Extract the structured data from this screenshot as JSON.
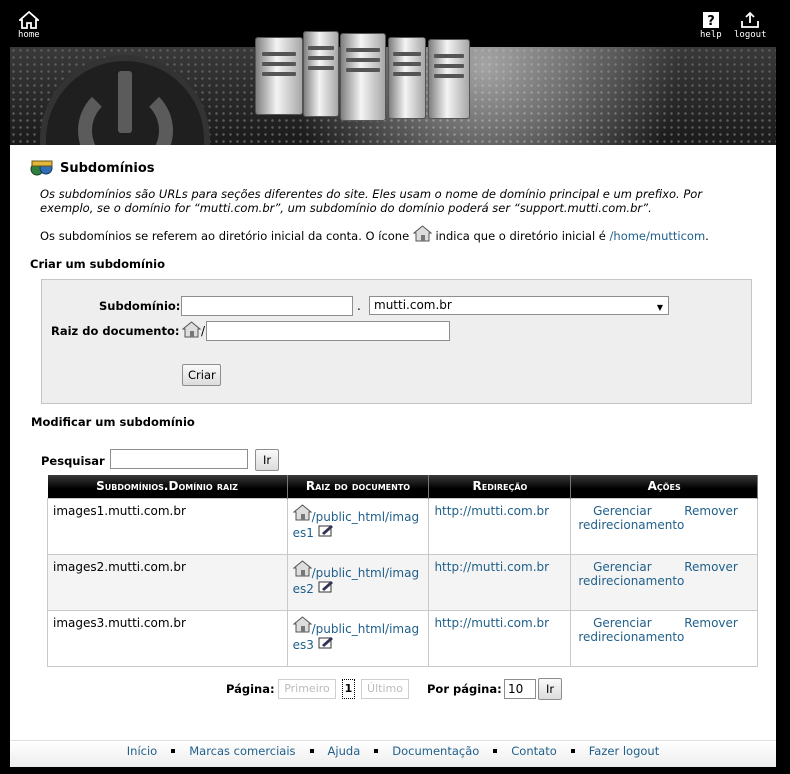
{
  "header": {
    "home_label": "home",
    "help_label": "help",
    "logout_label": "logout"
  },
  "page": {
    "title": "Subdomínios",
    "description": "Os subdomínios são URLs para seções diferentes do site. Eles usam o nome de domínio principal e um prefixo. Por exemplo, se o domínio for “mutti.com.br”, um subdomínio do domínio poderá ser “support.mutti.com.br”.",
    "note_prefix": "Os subdomínios se referem ao diretório inicial da conta. O ícone",
    "note_middle": "indica que o diretório inicial é",
    "home_path": "/home/mutticom",
    "note_suffix": "."
  },
  "create": {
    "heading": "Criar um subdomínio",
    "subdomain_label": "Subdomínio:",
    "subdomain_value": "",
    "dot": ".",
    "domain_selected": "mutti.com.br",
    "docroot_label": "Raiz do documento:",
    "docroot_prefix": "/",
    "docroot_value": "",
    "submit_label": "Criar"
  },
  "modify": {
    "heading": "Modificar um subdomínio",
    "search_label": "Pesquisar",
    "search_value": "",
    "search_button": "Ir"
  },
  "table": {
    "columns": [
      "Subdomínios.Domínio raiz",
      "Raiz do documento",
      "Redireção",
      "Ações"
    ],
    "rows": [
      {
        "subdomain": "images1.mutti.com.br",
        "docroot_a": "/public_html/imag",
        "docroot_b": "es1",
        "redirect": "http://mutti.com.br",
        "manage": "Gerenciar redirecionamento",
        "remove": "Remover"
      },
      {
        "subdomain": "images2.mutti.com.br",
        "docroot_a": "/public_html/imag",
        "docroot_b": "es2",
        "redirect": "http://mutti.com.br",
        "manage": "Gerenciar redirecionamento",
        "remove": "Remover"
      },
      {
        "subdomain": "images3.mutti.com.br",
        "docroot_a": "/public_html/imag",
        "docroot_b": "es3",
        "redirect": "http://mutti.com.br",
        "manage": "Gerenciar redirecionamento",
        "remove": "Remover"
      }
    ]
  },
  "pagination": {
    "page_label": "Página:",
    "first": "Primeiro",
    "current": "1",
    "last": "Último",
    "per_page_label": "Por página:",
    "per_page_value": "10",
    "go": "Ir"
  },
  "footer": {
    "links": [
      "Início",
      "Marcas comerciais",
      "Ajuda",
      "Documentação",
      "Contato",
      "Fazer logout"
    ]
  },
  "colors": {
    "link": "#1f5f8a",
    "table_header": "#000000",
    "form_box": "#eeeeee"
  }
}
